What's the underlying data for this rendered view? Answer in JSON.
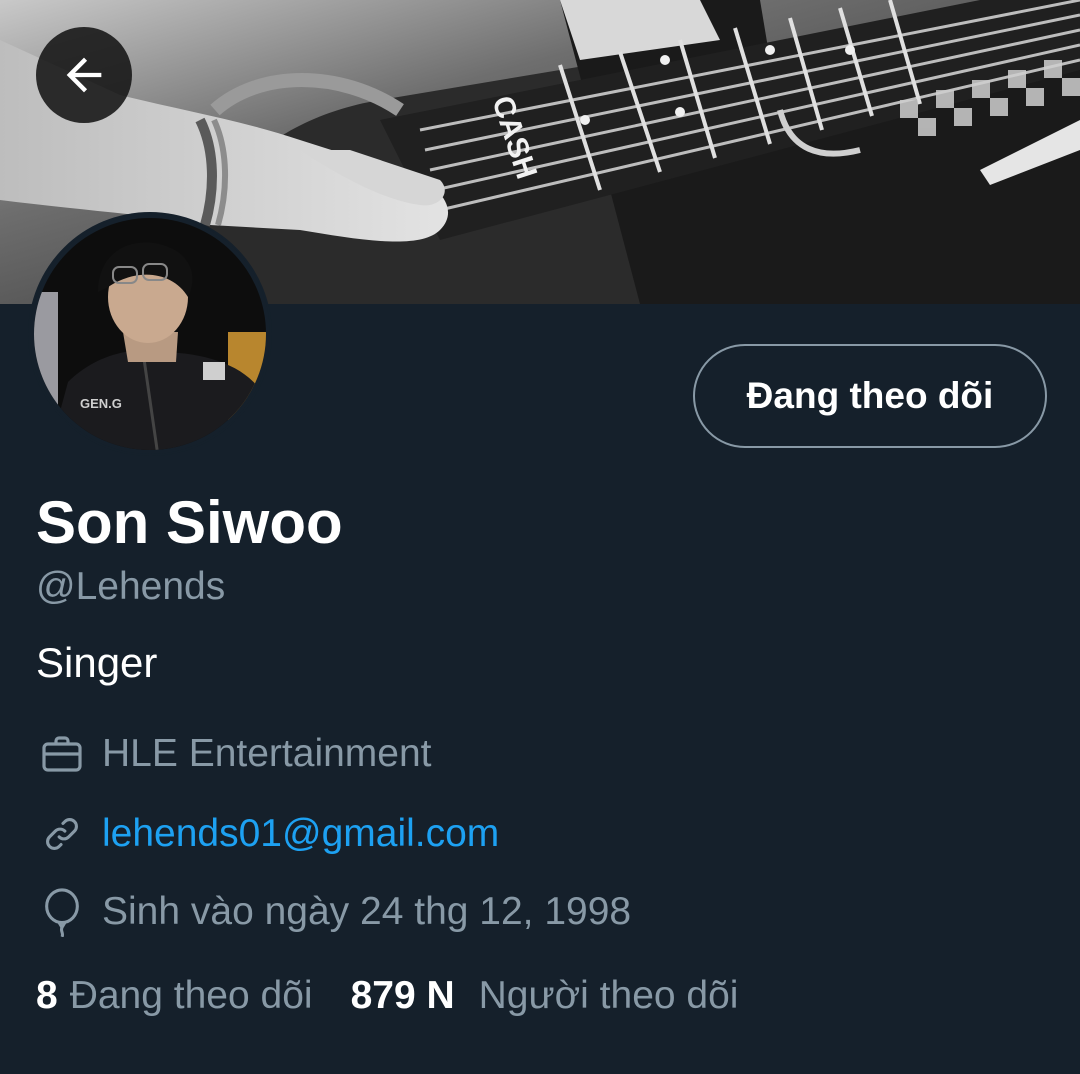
{
  "profile": {
    "name": "Son Siwoo",
    "handle": "@Lehends",
    "bio": "Singer",
    "work": "HLE Entertainment",
    "link": "lehends01@gmail.com",
    "birthday": "Sinh vào ngày 24 thg 12, 1998"
  },
  "banner": {
    "guitar_label": "CASH"
  },
  "follow_button": {
    "label": "Đang theo dõi"
  },
  "stats": {
    "following_count": "8",
    "following_label": "Đang theo dõi",
    "followers_count": "879 N",
    "followers_label": "Người theo dõi"
  },
  "colors": {
    "background": "#15202b",
    "secondary_text": "#8899a6",
    "link": "#1da1f2"
  }
}
